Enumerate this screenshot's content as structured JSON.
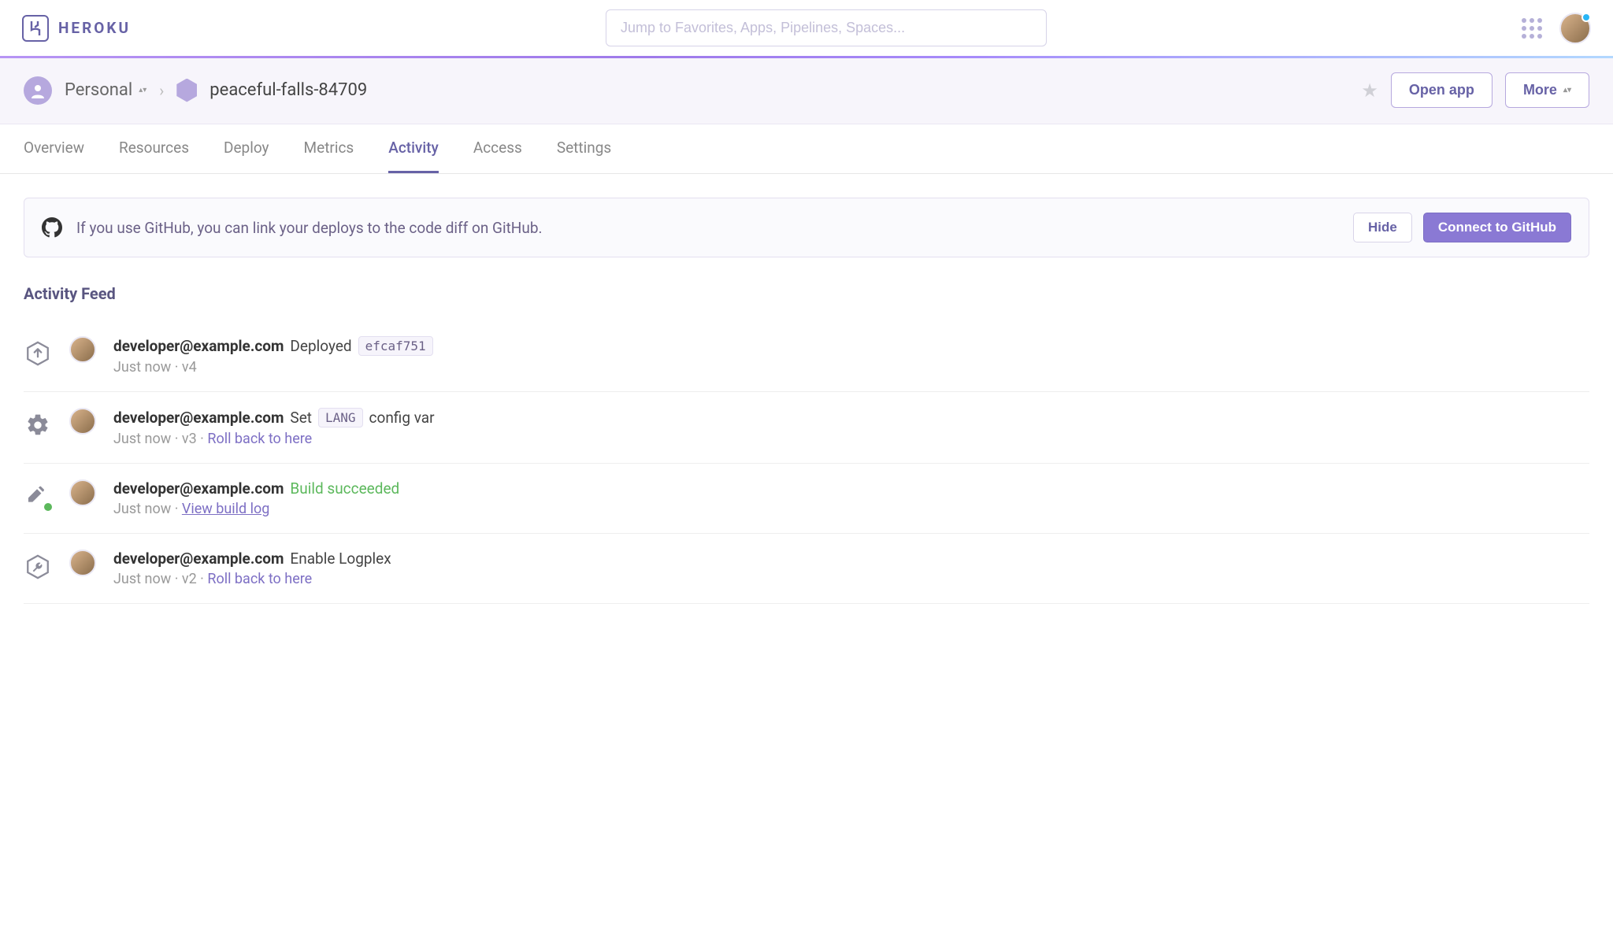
{
  "brand": "HEROKU",
  "search": {
    "placeholder": "Jump to Favorites, Apps, Pipelines, Spaces..."
  },
  "breadcrumb": {
    "team": "Personal",
    "app": "peaceful-falls-84709",
    "open_label": "Open app",
    "more_label": "More"
  },
  "tabs": {
    "overview": "Overview",
    "resources": "Resources",
    "deploy": "Deploy",
    "metrics": "Metrics",
    "activity": "Activity",
    "access": "Access",
    "settings": "Settings"
  },
  "banner": {
    "text": "If you use GitHub, you can link your deploys to the code diff on GitHub.",
    "hide": "Hide",
    "connect": "Connect to GitHub"
  },
  "feed": {
    "title": "Activity Feed",
    "items": [
      {
        "user": "developer@example.com",
        "action": "Deployed",
        "chip": "efcaf751",
        "time": "Just now",
        "version": "v4"
      },
      {
        "user": "developer@example.com",
        "action": "Set",
        "chip": "LANG",
        "suffix": "config var",
        "time": "Just now",
        "version": "v3",
        "rollback": "Roll back to here"
      },
      {
        "user": "developer@example.com",
        "status": "Build succeeded",
        "time": "Just now",
        "log": "View build log"
      },
      {
        "user": "developer@example.com",
        "action": "Enable Logplex",
        "time": "Just now",
        "version": "v2",
        "rollback": "Roll back to here"
      }
    ]
  }
}
